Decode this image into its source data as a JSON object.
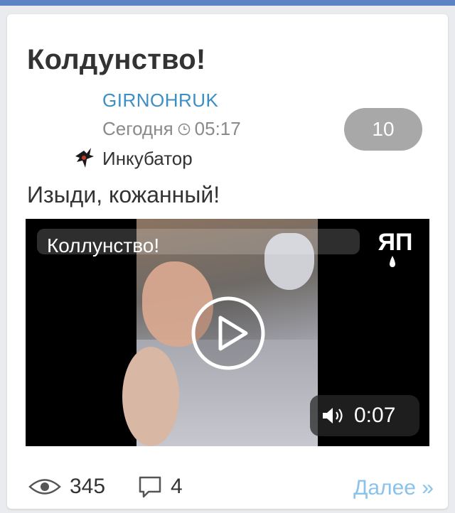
{
  "post": {
    "title": "Колдунство!",
    "author": "GIRNOHRUK",
    "date": "Сегодня",
    "time": "05:17",
    "community": "Инкубатор",
    "rating": "10",
    "text": "Изыди, кожанный!"
  },
  "video": {
    "title": "Коллунство!",
    "duration": "0:07",
    "logo": "ЯП",
    "icons": {
      "play": "play-icon",
      "sound": "sound-icon"
    }
  },
  "footer": {
    "views": "345",
    "comments": "4",
    "more_label": "Далее »"
  },
  "colors": {
    "accent": "#3b8fc6",
    "link": "#89c3ec",
    "topbar": "#5b84c4",
    "rating_bg": "#a8a8a8"
  }
}
